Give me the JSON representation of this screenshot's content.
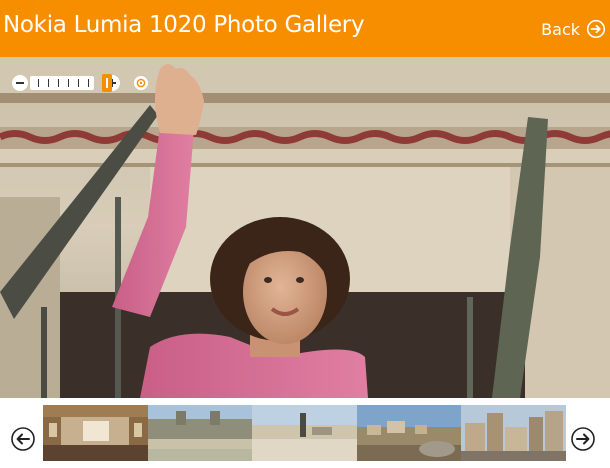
{
  "app": {
    "title": "Nokia Lumia 1020 Photo Gallery",
    "accent_color": "#f78e00"
  },
  "header": {
    "back_label": "Back",
    "back_icon": "arrow-right-circle-icon"
  },
  "viewer": {
    "zoom_level_fraction": 1.0,
    "zoom_out_icon": "minus-icon",
    "zoom_in_icon": "plus-icon",
    "reset_icon": "target-icon",
    "photo_subject": "woman-waving-photo"
  },
  "filmstrip": {
    "prev_icon": "arrow-left-circle-icon",
    "next_icon": "arrow-right-circle-icon",
    "thumbnails": [
      {
        "name": "thumbnail-interior-hall"
      },
      {
        "name": "thumbnail-palace-fountain"
      },
      {
        "name": "thumbnail-plaza-statue"
      },
      {
        "name": "thumbnail-coastal-town"
      },
      {
        "name": "thumbnail-city-buildings"
      }
    ]
  }
}
